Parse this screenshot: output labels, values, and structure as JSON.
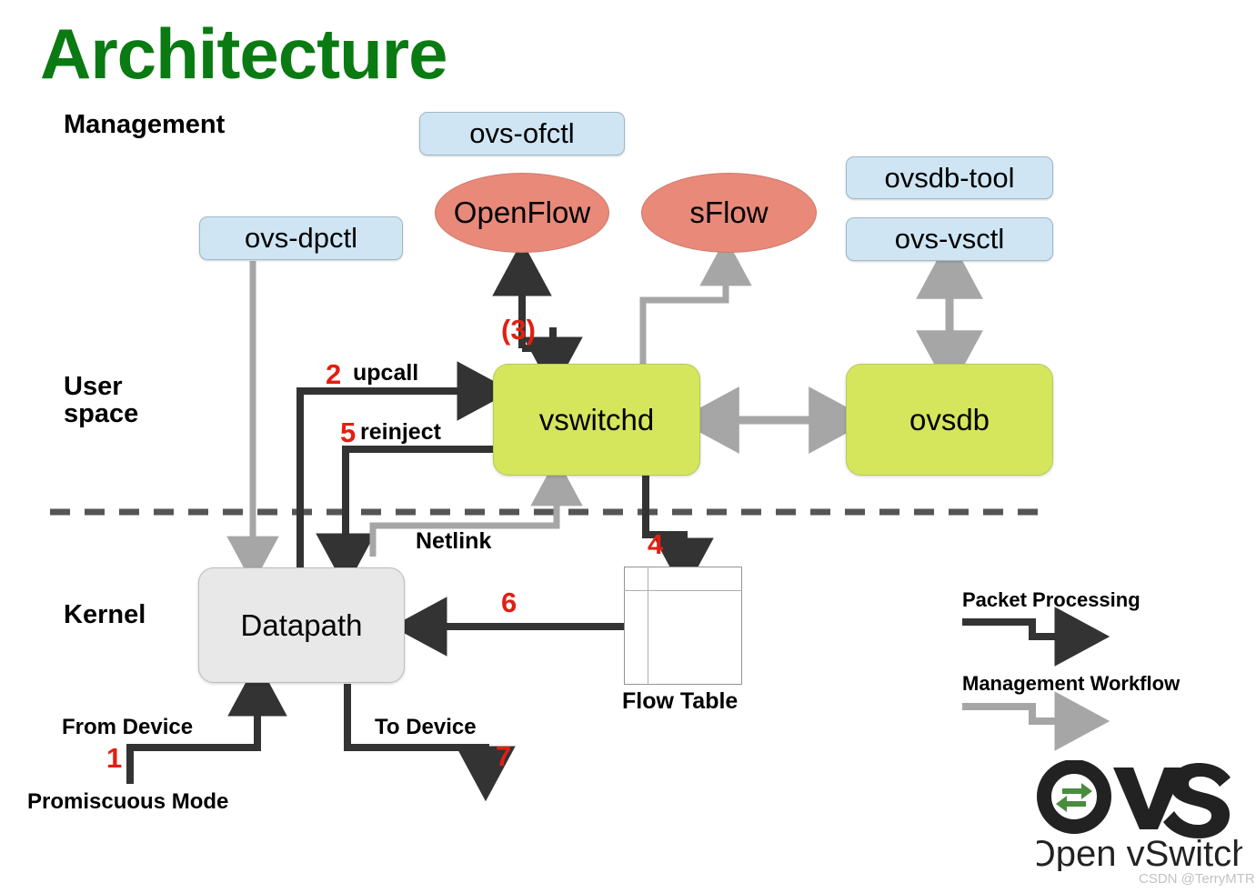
{
  "title": "Architecture",
  "zones": [
    {
      "id": "management",
      "label": "Management"
    },
    {
      "id": "user-space",
      "label": "User\nspace",
      "line1": "User",
      "line2": "space"
    },
    {
      "id": "kernel",
      "label": "Kernel"
    }
  ],
  "management_tools": [
    {
      "id": "ovs-ofctl",
      "label": "ovs-ofctl"
    },
    {
      "id": "ovs-dpctl",
      "label": "ovs-dpctl"
    },
    {
      "id": "ovsdb-tool",
      "label": "ovsdb-tool"
    },
    {
      "id": "ovs-vsctl",
      "label": "ovs-vsctl"
    }
  ],
  "protocols": [
    {
      "id": "openflow",
      "label": "OpenFlow"
    },
    {
      "id": "sflow",
      "label": "sFlow"
    }
  ],
  "daemons": [
    {
      "id": "vswitchd",
      "label": "vswitchd"
    },
    {
      "id": "ovsdb",
      "label": "ovsdb"
    }
  ],
  "kernel_components": [
    {
      "id": "datapath",
      "label": "Datapath"
    },
    {
      "id": "flow-table",
      "label": "Flow Table"
    }
  ],
  "edge_labels": {
    "upcall": "upcall",
    "reinject": "reinject",
    "netlink": "Netlink",
    "from_device": "From Device",
    "to_device": "To Device",
    "promiscuous_mode": "Promiscuous Mode"
  },
  "step_numbers": {
    "s1": "1",
    "s2": "2",
    "s3": "(3)",
    "s4": "4",
    "s5": "5",
    "s6": "6",
    "s7": "7"
  },
  "legend": [
    {
      "id": "packet-processing",
      "label": "Packet Processing",
      "color": "#333333"
    },
    {
      "id": "management-workflow",
      "label": "Management Workflow",
      "color": "#a6a6a6"
    }
  ],
  "logo": {
    "mark": "OvS",
    "wordmark": "Open vSwitch"
  },
  "watermark": "CSDN @TerryMTR",
  "colors": {
    "title": "#0a7a12",
    "mgmt_box": "#cfe5f3",
    "protocol_ellipse": "#e8897a",
    "daemon_box": "#d6e65c",
    "kernel_box": "#e8e8e8",
    "step_number": "#e21f11",
    "packet_arrow": "#333333",
    "mgmt_arrow": "#a6a6a6",
    "logo_green": "#4a8c3f"
  }
}
